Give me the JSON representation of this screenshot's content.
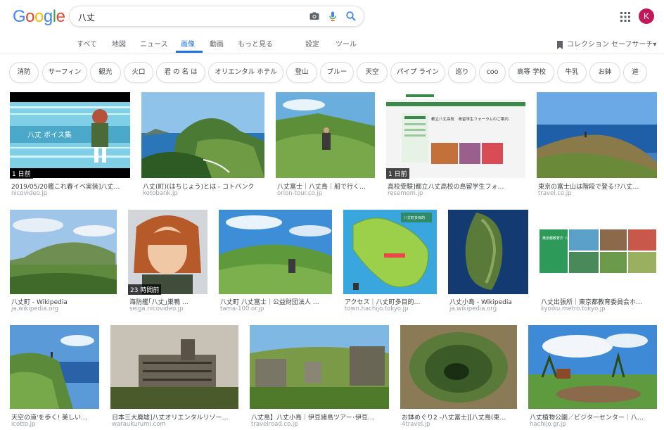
{
  "logo": [
    "G",
    "o",
    "o",
    "g",
    "l",
    "e"
  ],
  "logo_colors": [
    "#4285f4",
    "#ea4335",
    "#fbbc05",
    "#4285f4",
    "#34a853",
    "#ea4335"
  ],
  "search": {
    "query": "八丈"
  },
  "account": {
    "avatar_letter": "K"
  },
  "tabs": [
    "すべて",
    "地図",
    "ニュース",
    "画像",
    "動画",
    "もっと見る",
    "設定",
    "ツール"
  ],
  "active_tab": "画像",
  "collection": "コレクション",
  "safesearch": "セーフサーチ▾",
  "chips": [
    "消防",
    "サーフィン",
    "観光",
    "火口",
    "君 の 名 は",
    "オリエンタル ホテル",
    "登山",
    "ブルー",
    "天空",
    "パイプ ライン",
    "巡り",
    "coo",
    "高等 学校",
    "牛乳",
    "お鉢",
    "道"
  ],
  "results": [
    {
      "caption": "2019/05/20艦これ春イベ実装]八丈…",
      "source": "nicovideo.jp",
      "badge": "1 日前"
    },
    {
      "caption": "八丈(町)(はちじょう)とは - コトバンク",
      "source": "kotobank.jp",
      "badge": ""
    },
    {
      "caption": "八丈富士｜八丈島｜船で行く…",
      "source": "orion-tour.co.jp",
      "badge": ""
    },
    {
      "caption": "高校受験]都立八丈高校の島留学生フォ…",
      "source": "resemom.jp",
      "badge": "1 日前"
    },
    {
      "caption": "東京の富士山は階段で登る!?八丈…",
      "source": "travel.co.jp",
      "badge": ""
    },
    {
      "caption": "八丈町 - Wikipedia",
      "source": "ja.wikipedia.org",
      "badge": ""
    },
    {
      "caption": "海防艦｢八丈｣巣鴨 …",
      "source": "seiga.nicovideo.jp",
      "badge": "23 時間前"
    },
    {
      "caption": "八丈町 八丈富士｜公益財団法人 …",
      "source": "tama-100.or.jp",
      "badge": ""
    },
    {
      "caption": "アクセス｜八丈町多目的…",
      "source": "town.hachijo.tokyo.jp",
      "badge": ""
    },
    {
      "caption": "八丈小島 - Wikipedia",
      "source": "ja.wikipedia.org",
      "badge": ""
    },
    {
      "caption": "八丈出張所｜東京都教育委員会ホ…",
      "source": "kyoiku.metro.tokyo.jp",
      "badge": ""
    },
    {
      "caption": "天空の道'を歩く! 美しい…",
      "source": "icotto.jp",
      "badge": ""
    },
    {
      "caption": "日本三大廃墟]八丈オリエンタルリゾー…",
      "source": "waraukurumi.com",
      "badge": ""
    },
    {
      "caption": "八丈島】八丈小島｜伊豆諸島ツアー･伊豆…",
      "source": "travelroad.co.jp",
      "badge": ""
    },
    {
      "caption": "お鉢めぐり2 -八丈富士][八丈島(東…",
      "source": "4travel.jp",
      "badge": ""
    },
    {
      "caption": "八丈植物公園／ビジターセンター｜八…",
      "source": "hachijo.gr.jp",
      "badge": ""
    }
  ],
  "thumb_texts": {
    "voice": "八丈 ボイス集",
    "school_title": "都立八丈高校　島留学生フォーラムのご案内",
    "map_title": "八丈町多目的",
    "edu_title": "東京都教育庁\n八丈出張所"
  },
  "colors": {
    "accent": "#1a73e8",
    "chip_border": "#dadce0",
    "avatar": "#c2185b"
  }
}
